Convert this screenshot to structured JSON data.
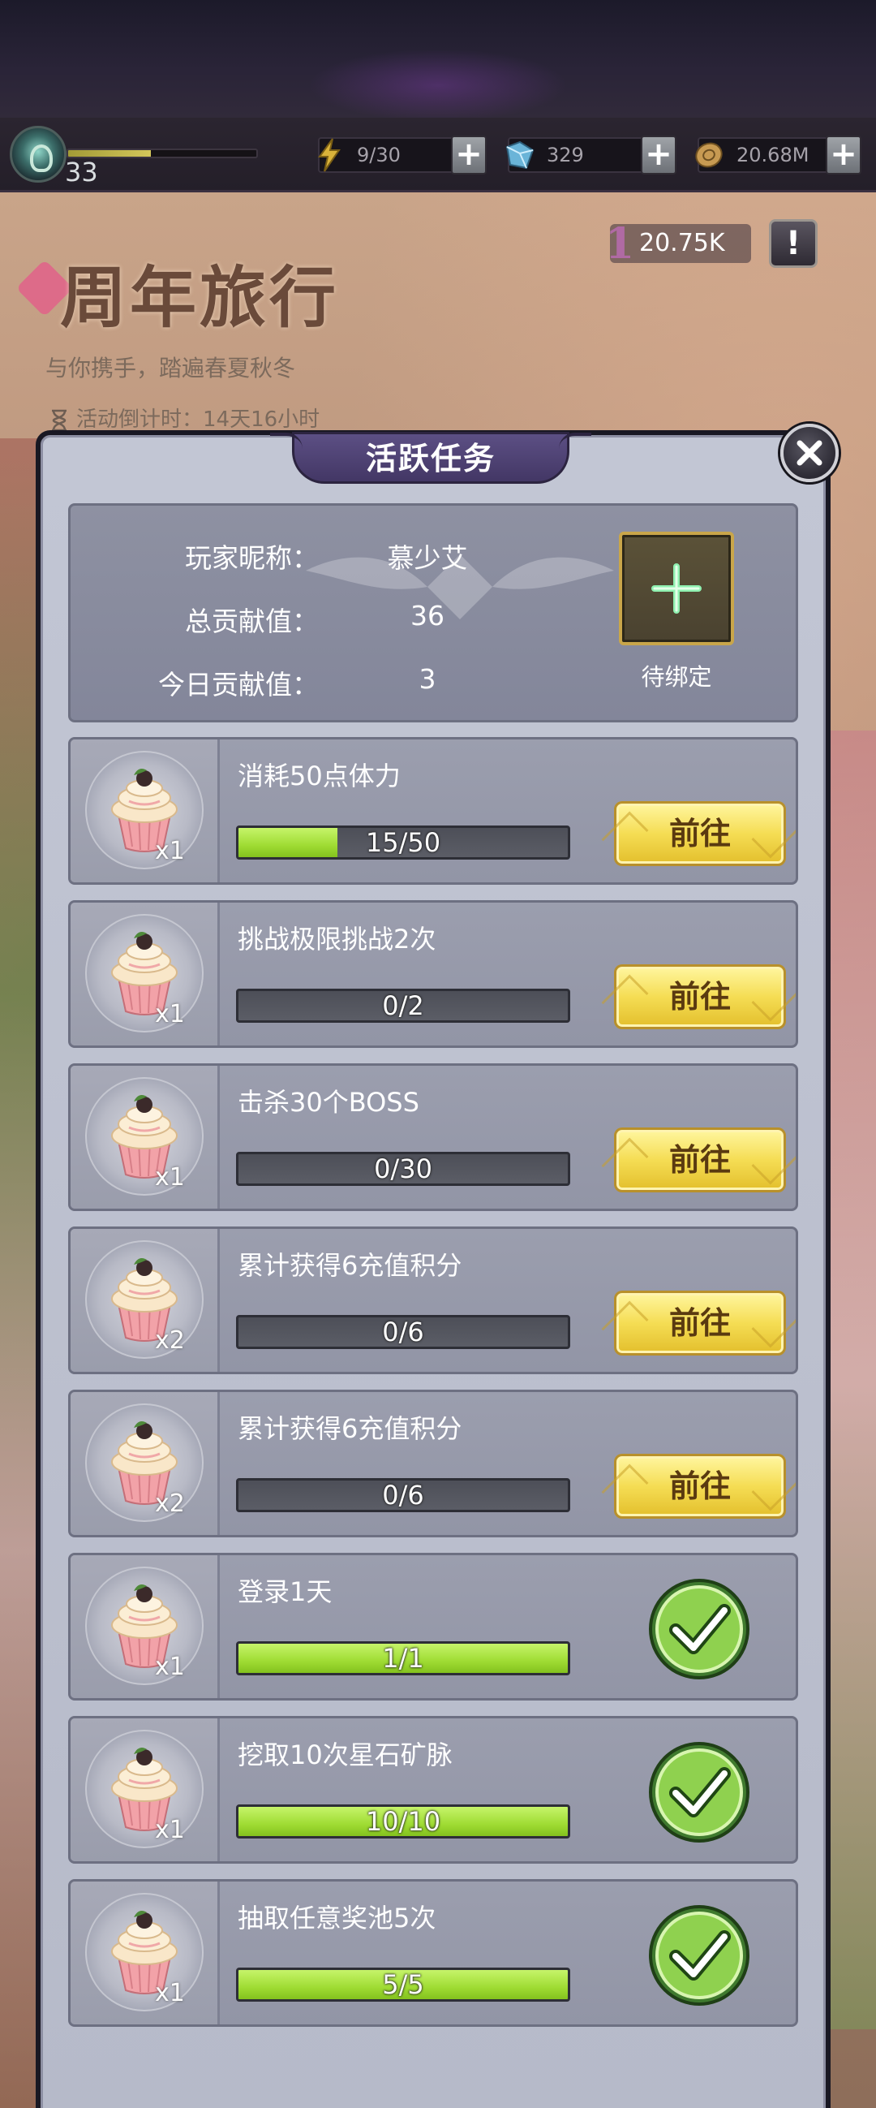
{
  "status": {
    "level": "33",
    "level_progress": 0.44,
    "stamina": "9/30",
    "gems": "329",
    "gold": "20.68M"
  },
  "event": {
    "title": "周年旅行",
    "subtitle": "与你携手，踏遍春夏秋冬",
    "countdown": "活动倒计时：14天16小时",
    "score_prefix": "1",
    "score": "20.75K",
    "info_label": "!"
  },
  "panel": {
    "title": "活跃任务",
    "player": {
      "name_label": "玩家昵称：",
      "name_value": "慕少艾",
      "total_label": "总贡献值：",
      "total_value": "36",
      "today_label": "今日贡献值：",
      "today_value": "3",
      "bind_label": "待绑定"
    },
    "tasks": [
      {
        "desc": "消耗50点体力",
        "reward": "x1",
        "progress_text": "15/50",
        "progress": 0.3,
        "action": "前往",
        "done": false
      },
      {
        "desc": "挑战极限挑战2次",
        "reward": "x1",
        "progress_text": "0/2",
        "progress": 0,
        "action": "前往",
        "done": false
      },
      {
        "desc": "击杀30个BOSS",
        "reward": "x1",
        "progress_text": "0/30",
        "progress": 0,
        "action": "前往",
        "done": false
      },
      {
        "desc": "累计获得6充值积分",
        "reward": "x2",
        "progress_text": "0/6",
        "progress": 0,
        "action": "前往",
        "done": false
      },
      {
        "desc": "累计获得6充值积分",
        "reward": "x2",
        "progress_text": "0/6",
        "progress": 0,
        "action": "前往",
        "done": false
      },
      {
        "desc": "登录1天",
        "reward": "x1",
        "progress_text": "1/1",
        "progress": 1,
        "action": "",
        "done": true
      },
      {
        "desc": "挖取10次星石矿脉",
        "reward": "x1",
        "progress_text": "10/10",
        "progress": 1,
        "action": "",
        "done": true
      },
      {
        "desc": "抽取任意奖池5次",
        "reward": "x1",
        "progress_text": "5/5",
        "progress": 1,
        "action": "",
        "done": true
      }
    ]
  },
  "icons": {
    "level": "level-emblem-icon",
    "stamina": "lightning-icon",
    "gems": "gem-icon",
    "gold": "coin-icon",
    "reward": "cupcake-icon",
    "done": "checkmark-icon",
    "close": "close-icon",
    "bind": "plus-icon"
  },
  "colors": {
    "progress_fill": "#9fdc33",
    "go_button": "#f5dd54",
    "panel_bg": "#c2c6d4",
    "title_tab": "#5c4f84"
  }
}
